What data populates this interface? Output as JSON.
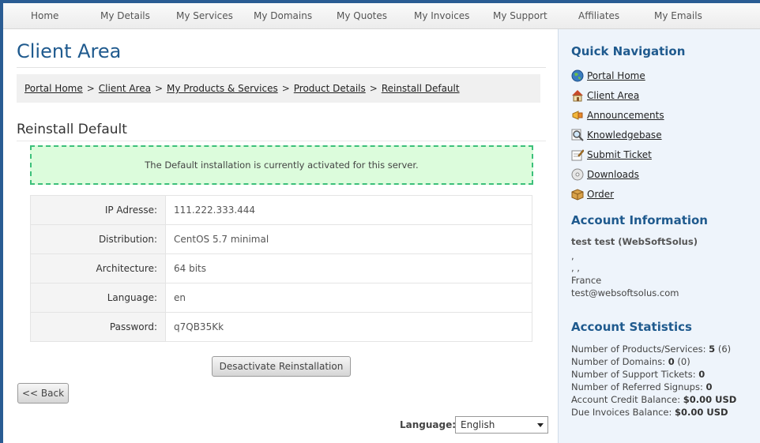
{
  "nav": [
    "Home",
    "My Details",
    "My Services",
    "My Domains",
    "My Quotes",
    "My Invoices",
    "My Support",
    "Affiliates",
    "My Emails"
  ],
  "main": {
    "title": "Client Area",
    "breadcrumb": [
      "Portal Home",
      "Client Area",
      "My Products & Services",
      "Product Details",
      "Reinstall Default"
    ],
    "breadcrumb_sep": ">",
    "subtitle": "Reinstall Default",
    "alert": "The Default installation is currently activated for this server.",
    "details": [
      {
        "label": "IP Adresse:",
        "value": "111.222.333.444"
      },
      {
        "label": "Distribution:",
        "value": "CentOS 5.7 minimal"
      },
      {
        "label": "Architecture:",
        "value": "64 bits"
      },
      {
        "label": "Language:",
        "value": "en"
      },
      {
        "label": "Password:",
        "value": "q7QB35Kk"
      }
    ],
    "deactivate_button": "Desactivate Reinstallation",
    "back_button": "<< Back",
    "language_label": "Language:",
    "language_value": "English"
  },
  "sidebar": {
    "quick_nav_title": "Quick Navigation",
    "quick_nav": [
      {
        "label": "Portal Home",
        "icon": "globe-icon"
      },
      {
        "label": "Client Area",
        "icon": "house-icon"
      },
      {
        "label": "Announcements",
        "icon": "megaphone-icon"
      },
      {
        "label": "Knowledgebase",
        "icon": "magnifier-icon"
      },
      {
        "label": "Submit Ticket",
        "icon": "ticket-icon"
      },
      {
        "label": "Downloads",
        "icon": "disc-icon"
      },
      {
        "label": "Order",
        "icon": "box-icon"
      }
    ],
    "account_info_title": "Account Information",
    "account_name": "test test (WebSoftSolus)",
    "address_line1": ",",
    "address_line2": ", ,",
    "country": "France",
    "email": "test@websoftsolus.com",
    "stats_title": "Account Statistics",
    "stats": [
      {
        "label": "Number of Products/Services:",
        "value": "5",
        "extra": "(6)"
      },
      {
        "label": "Number of Domains:",
        "value": "0",
        "extra": "(0)"
      },
      {
        "label": "Number of Support Tickets:",
        "value": "0",
        "extra": ""
      },
      {
        "label": "Number of Referred Signups:",
        "value": "0",
        "extra": ""
      },
      {
        "label": "Account Credit Balance:",
        "value": "$0.00 USD",
        "extra": ""
      },
      {
        "label": "Due Invoices Balance:",
        "value": "$0.00 USD",
        "extra": ""
      }
    ]
  }
}
